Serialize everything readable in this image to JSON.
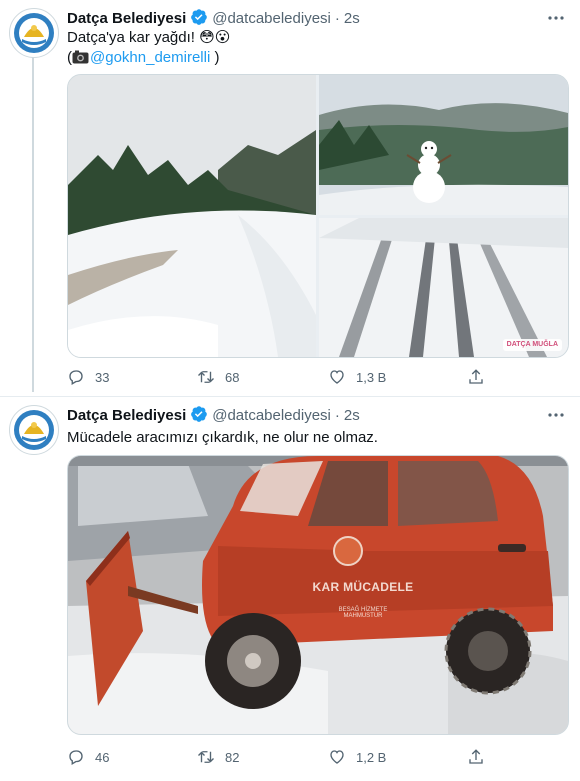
{
  "tweets": [
    {
      "name": "Datça Belediyesi",
      "handle": "@datcabelediyesi",
      "time": "2s",
      "text_line1": "Datça'ya kar yağdı! 😳😮",
      "credit_open": "(",
      "credit_link": "@gokhn_demirelli",
      "credit_close": " )",
      "watermark": "DATÇA MUĞLA",
      "replies": "33",
      "retweets": "68",
      "likes": "1,3 B",
      "icons": [
        "verified-badge",
        "more-icon",
        "camera-icon",
        "reply-icon",
        "retweet-icon",
        "like-icon",
        "share-icon"
      ]
    },
    {
      "name": "Datça Belediyesi",
      "handle": "@datcabelediyesi",
      "time": "2s",
      "text_line1": "Mücadele aracımızı çıkardık, ne olur ne olmaz.",
      "car_label": "KAR MÜCADELE",
      "car_sublabel_1": "BESAĞ HİZMETE",
      "car_sublabel_2": "MAHMUSTUR",
      "replies": "46",
      "retweets": "82",
      "likes": "1,2 B"
    }
  ],
  "colors": {
    "brand": "#1d9bf0",
    "text": "#0f1419",
    "muted": "#536471",
    "car": "#c8472c"
  }
}
